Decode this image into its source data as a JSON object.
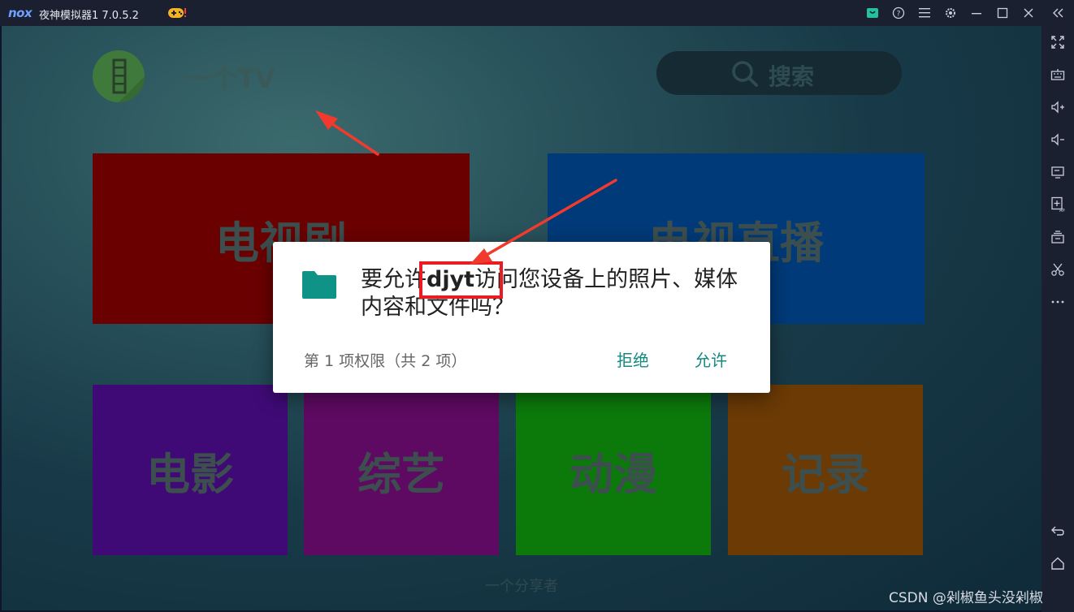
{
  "window": {
    "logo": "nox",
    "title": "夜神模拟器1 7.0.5.2",
    "controls": [
      "shop-icon",
      "help-icon",
      "menu-icon",
      "settings-icon",
      "minimize-icon",
      "maximize-icon",
      "close-icon",
      "collapse-sidebar-icon"
    ]
  },
  "sidebar": {
    "items": [
      "fullscreen-icon",
      "keyboard-icon",
      "volume-up-icon",
      "volume-down-icon",
      "screen-icon",
      "install-apk-icon",
      "multi-instance-icon",
      "scissors-icon",
      "more-icon",
      "back-icon",
      "home-icon"
    ]
  },
  "app": {
    "title": "一个TV",
    "search_label": "搜索",
    "tiles": [
      {
        "label": "电视剧",
        "color": "#6b0000"
      },
      {
        "label": "电视直播",
        "color": "#003a78"
      },
      {
        "label": "电影",
        "color": "#3f0a76"
      },
      {
        "label": "综艺",
        "color": "#5e0a62"
      },
      {
        "label": "动漫",
        "color": "#0b7a0b"
      },
      {
        "label": "记录",
        "color": "#6b3a05"
      }
    ],
    "footer": "一个分享者"
  },
  "dialog": {
    "message_before": "要允许",
    "app_name": "djyt",
    "message_after": "访问您设备上的照片、媒体内容和文件吗？",
    "permission_count": "第 1 项权限（共 2 项）",
    "deny_label": "拒绝",
    "allow_label": "允许",
    "accent_color": "#138a80"
  },
  "watermark": "CSDN @剁椒鱼头没剁椒"
}
